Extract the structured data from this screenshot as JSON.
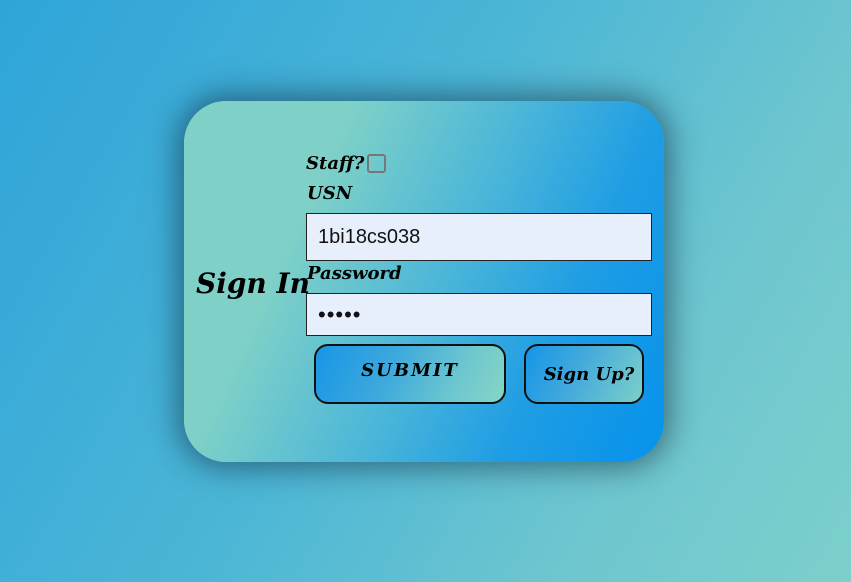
{
  "form": {
    "title": "Sign In",
    "staff_label": "Staff?",
    "staff_checked": false,
    "usn_label": "USN",
    "usn_value": "1bi18cs038",
    "password_label": "Password",
    "password_masked": "•••••",
    "submit_label": "SUBMIT",
    "signup_label": "Sign Up?"
  }
}
